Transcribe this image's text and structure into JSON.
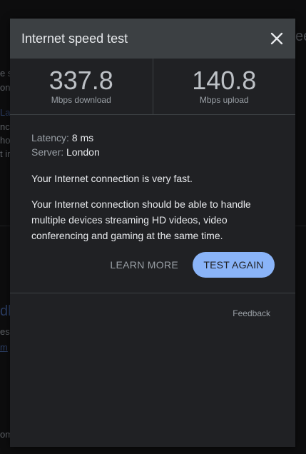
{
  "modal": {
    "title": "Internet speed test",
    "download": {
      "value": "337.8",
      "unit": "Mbps download"
    },
    "upload": {
      "value": "140.8",
      "unit": "Mbps upload"
    },
    "latency_label": "Latency:",
    "latency_value": "8 ms",
    "server_label": "Server:",
    "server_value": "London",
    "summary": "Your Internet connection is very fast.",
    "description": "Your Internet connection should be able to handle multiple devices streaming HD videos, video conferencing and gaming at the same time.",
    "learn_more_label": "LEARN MORE",
    "test_again_label": "TEST AGAIN",
    "feedback_label": "Feedback"
  },
  "backdrop": {
    "frag1": "e sp",
    "frag2": "on",
    "frag3": "La",
    "frag4": "nc",
    "frag5": "hot",
    "frag6": "t ir",
    "frag7": "db",
    "frag8": "es",
    "frag9": "m",
    "frag10": "om",
    "frag_right": "ee"
  },
  "colors": {
    "modal_bg": "#202124",
    "header_bg": "#3c4043",
    "accent": "#8ab4f8"
  }
}
